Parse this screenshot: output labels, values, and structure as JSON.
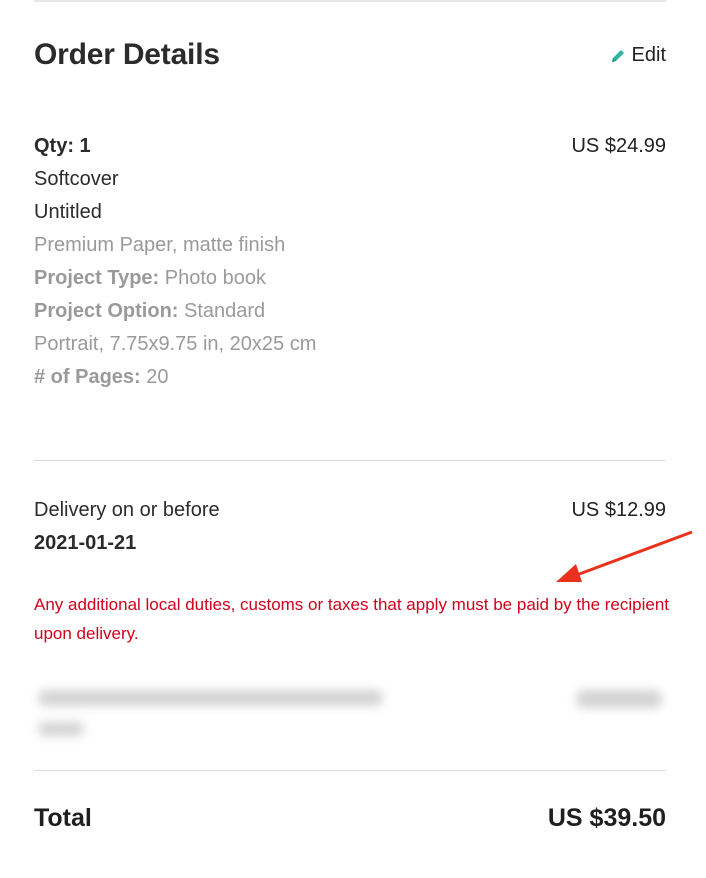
{
  "header": {
    "title": "Order Details",
    "edit_label": "Edit",
    "edit_icon": "pencil-icon",
    "accent_color": "#2bb5a2"
  },
  "item": {
    "qty_label": "Qty: 1",
    "price": "US $24.99",
    "format": "Softcover",
    "name": "Untitled",
    "paper": "Premium Paper, matte finish",
    "project_type_label": "Project Type:",
    "project_type_value": " Photo book",
    "project_option_label": "Project Option:",
    "project_option_value": " Standard Portrait, 7.75x9.75 in, 20x25 cm",
    "pages_label": "# of Pages:",
    "pages_value": " 20"
  },
  "delivery": {
    "label": "Delivery on or before",
    "date": "2021-01-21",
    "price": "US $12.99",
    "notice": "Any additional local duties, customs or taxes that apply must be paid by the recipient upon delivery.",
    "notice_color": "#d0021b"
  },
  "annotation": {
    "arrow_color": "#e8321e"
  },
  "total": {
    "label": "Total",
    "value": "US $39.50"
  }
}
